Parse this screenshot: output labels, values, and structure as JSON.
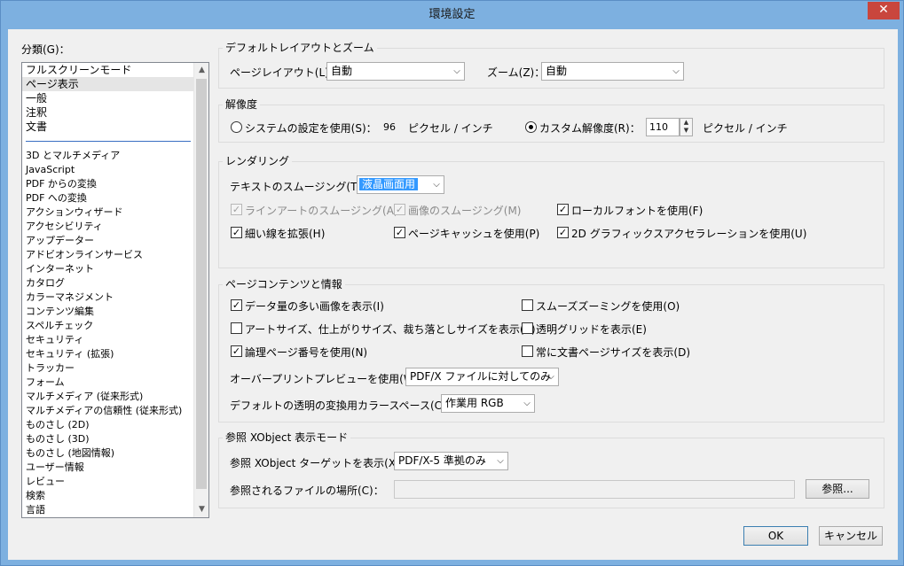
{
  "window": {
    "title": "環境設定",
    "close_glyph": "✕"
  },
  "categories": {
    "label": "分類(G)：",
    "top_items": [
      "フルスクリーンモード",
      "ページ表示",
      "一般",
      "注釈",
      "文書"
    ],
    "items": [
      "3D とマルチメディア",
      "JavaScript",
      "PDF からの変換",
      "PDF への変換",
      "アクションウィザード",
      "アクセシビリティ",
      "アップデーター",
      "アドビオンラインサービス",
      "インターネット",
      "カタログ",
      "カラーマネジメント",
      "コンテンツ編集",
      "スペルチェック",
      "セキュリティ",
      "セキュリティ (拡張)",
      "トラッカー",
      "フォーム",
      "マルチメディア (従来形式)",
      "マルチメディアの信頼性 (従来形式)",
      "ものさし (2D)",
      "ものさし (3D)",
      "ものさし (地図情報)",
      "ユーザー情報",
      "レビュー",
      "検索",
      "言語"
    ]
  },
  "layout_zoom": {
    "title": "デフォルトレイアウトとズーム",
    "page_layout_label": "ページレイアウト(L)：",
    "page_layout_value": "自動",
    "zoom_label": "ズーム(Z)：",
    "zoom_value": "自動"
  },
  "resolution": {
    "title": "解像度",
    "system_label": "システムの設定を使用(S)：",
    "system_value": "96",
    "system_unit": "ピクセル / インチ",
    "custom_label": "カスタム解像度(R)：",
    "custom_value": "110",
    "custom_unit": "ピクセル / インチ"
  },
  "rendering": {
    "title": "レンダリング",
    "smoothing_label": "テキストのスムージング(T)：",
    "smoothing_value": "液晶画面用",
    "lineart": "ラインアートのスムージング(A)",
    "image": "画像のスムージング(M)",
    "localfont": "ローカルフォントを使用(F)",
    "thinlines": "細い線を拡張(H)",
    "pagecache": "ページキャッシュを使用(P)",
    "accel": "2D グラフィックスアクセラレーションを使用(U)"
  },
  "content": {
    "title": "ページコンテンツと情報",
    "large_images": "データ量の多い画像を表示(I)",
    "smooth_zoom": "スムーズズーミングを使用(O)",
    "art_sizes": "アートサイズ、仕上がりサイズ、裁ち落としサイズを表示(B)",
    "transparency_grid": "透明グリッドを表示(E)",
    "logical_page": "論理ページ番号を使用(N)",
    "always_doc_size": "常に文書ページサイズを表示(D)",
    "overprint_label": "オーバープリントプレビューを使用(W)：",
    "overprint_value": "PDF/X ファイルに対してのみ",
    "blend_label": "デフォルトの透明の変換用カラースペース(C)：",
    "blend_value": "作業用 RGB"
  },
  "xobject": {
    "title": "参照 XObject 表示モード",
    "target_label": "参照 XObject ターゲットを表示(X)：",
    "target_value": "PDF/X-5 準拠のみ",
    "location_label": "参照されるファイルの場所(C)：",
    "location_value": "",
    "browse_label": "参照..."
  },
  "footer": {
    "ok": "OK",
    "cancel": "キャンセル"
  },
  "glyphs": {
    "check": "✓",
    "combo_arrow": "⌵",
    "up": "▲",
    "down": "▼"
  }
}
